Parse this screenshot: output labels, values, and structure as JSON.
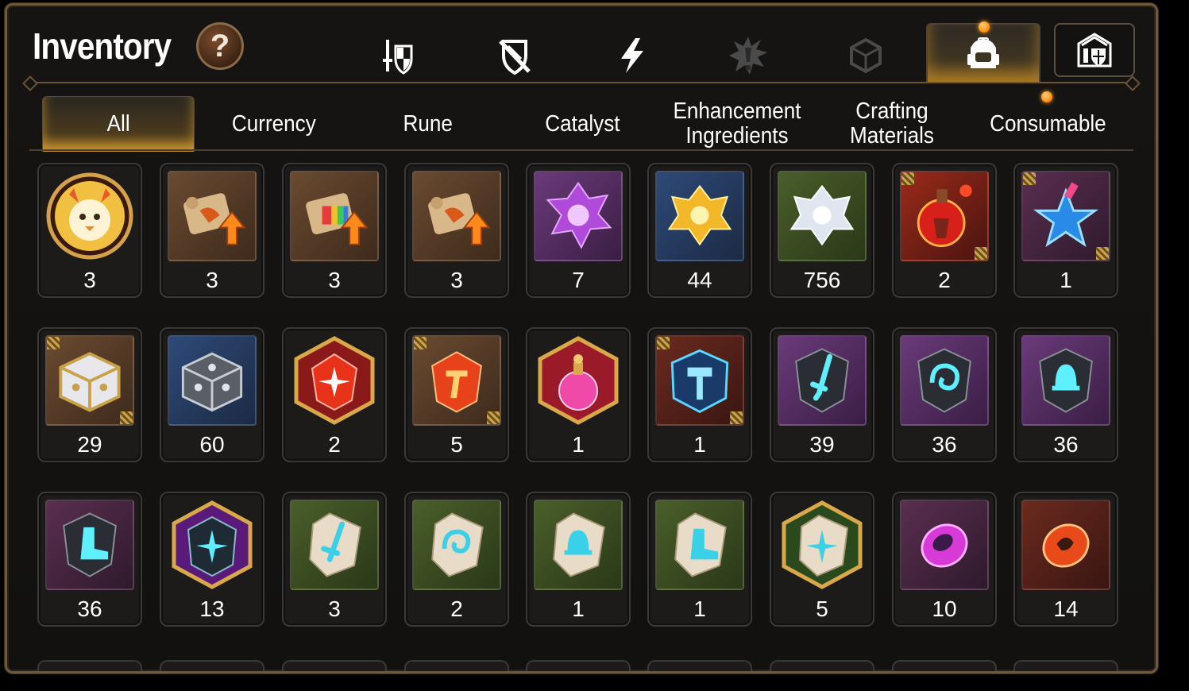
{
  "header": {
    "title": "Inventory",
    "help_label": "?"
  },
  "category_tabs": [
    {
      "name": "equipment",
      "icon": "sword-shield-icon",
      "active": false
    },
    {
      "name": "no-defense",
      "icon": "crossed-shield-icon",
      "active": false
    },
    {
      "name": "speed",
      "icon": "lightning-icon",
      "active": false
    },
    {
      "name": "special",
      "icon": "burst-icon",
      "active": false
    },
    {
      "name": "gem",
      "icon": "cube-icon",
      "active": false
    },
    {
      "name": "items",
      "icon": "backpack-icon",
      "active": true
    },
    {
      "name": "storage",
      "icon": "castle-shield-icon",
      "active": false
    }
  ],
  "sub_tabs": [
    {
      "label": "All",
      "active": true
    },
    {
      "label": "Currency",
      "active": false
    },
    {
      "label": "Rune",
      "active": false
    },
    {
      "label": "Catalyst",
      "active": false
    },
    {
      "label": "Enhancement Ingredients",
      "active": false
    },
    {
      "label": "Crafting Materials",
      "active": false
    },
    {
      "label": "Consumable",
      "active": false
    }
  ],
  "items": [
    {
      "icon": "mascot-coin-icon",
      "count": "3"
    },
    {
      "icon": "scroll-upgrade-icon",
      "count": "3"
    },
    {
      "icon": "scroll-rainbow-upgrade-icon",
      "count": "3"
    },
    {
      "icon": "scroll-upgrade-icon",
      "count": "3"
    },
    {
      "icon": "purple-crystal-icon",
      "count": "7"
    },
    {
      "icon": "gold-crystal-icon",
      "count": "44"
    },
    {
      "icon": "silver-crystal-icon",
      "count": "756"
    },
    {
      "icon": "red-potion-icon",
      "count": "2"
    },
    {
      "icon": "star-potion-icon",
      "count": "1"
    },
    {
      "icon": "ornate-chest-icon",
      "count": "29"
    },
    {
      "icon": "steel-chest-icon",
      "count": "60"
    },
    {
      "icon": "red-rune-hex-icon",
      "count": "2"
    },
    {
      "icon": "red-rune-icon",
      "count": "5"
    },
    {
      "icon": "pink-potion-hex-icon",
      "count": "1"
    },
    {
      "icon": "hammer-stone-icon",
      "count": "1"
    },
    {
      "icon": "sword-rune-stone-icon",
      "count": "39"
    },
    {
      "icon": "spiral-rune-stone-icon",
      "count": "36"
    },
    {
      "icon": "bell-rune-stone-icon",
      "count": "36"
    },
    {
      "icon": "boot-rune-stone-icon",
      "count": "36"
    },
    {
      "icon": "star-rune-hex-icon",
      "count": "13"
    },
    {
      "icon": "sword-rune-tablet-icon",
      "count": "3"
    },
    {
      "icon": "spiral-rune-tablet-icon",
      "count": "2"
    },
    {
      "icon": "bell-rune-tablet-icon",
      "count": "1"
    },
    {
      "icon": "boot-rune-tablet-icon",
      "count": "1"
    },
    {
      "icon": "star-rune-tablet-hex-icon",
      "count": "5"
    },
    {
      "icon": "purple-orb-icon",
      "count": "10"
    },
    {
      "icon": "fire-orb-icon",
      "count": "14"
    }
  ]
}
